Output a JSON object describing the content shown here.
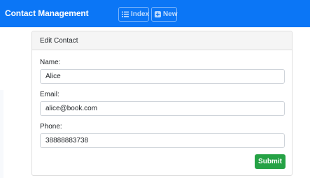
{
  "navbar": {
    "brand": "Contact Management",
    "background_color": "#0b76f6",
    "buttons": [
      {
        "label": "Index",
        "icon": "list-icon"
      },
      {
        "label": "New",
        "icon": "plus-square-icon"
      }
    ]
  },
  "card": {
    "title": "Edit Contact",
    "fields": [
      {
        "label": "Name:",
        "value": "Alice"
      },
      {
        "label": "Email:",
        "value": "alice@book.com"
      },
      {
        "label": "Phone:",
        "value": "38888883738"
      }
    ],
    "submit_label": "Submit",
    "submit_color": "#25a245"
  }
}
